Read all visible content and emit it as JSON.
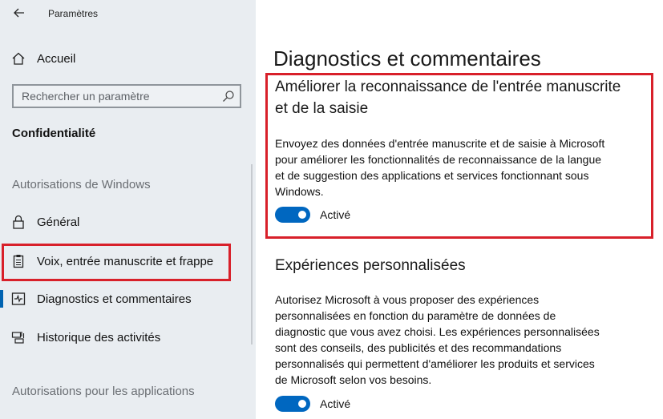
{
  "window": {
    "title": "Paramètres"
  },
  "sidebar": {
    "home_label": "Accueil",
    "search_placeholder": "Rechercher un paramètre",
    "section_title": "Confidentialité",
    "group_windows": "Autorisations de Windows",
    "items": [
      {
        "label": "Général",
        "icon": "lock-icon"
      },
      {
        "label": "Voix, entrée manuscrite et frappe",
        "icon": "clipboard-icon"
      },
      {
        "label": "Diagnostics et commentaires",
        "icon": "diagnostics-icon",
        "selected": true
      },
      {
        "label": "Historique des activités",
        "icon": "history-icon"
      }
    ],
    "group_apps": "Autorisations pour les applications"
  },
  "main": {
    "title": "Diagnostics et commentaires",
    "sections": [
      {
        "heading_line1": "Améliorer la reconnaissance de l'entrée manuscrite",
        "heading_line2": "et de la saisie",
        "body_lines": [
          "Envoyez des données d'entrée manuscrite et de saisie à Microsoft",
          "pour améliorer les fonctionnalités de reconnaissance de la langue",
          "et de suggestion des applications et services fonctionnant sous",
          "Windows."
        ],
        "toggle_state": "Activé"
      },
      {
        "heading": "Expériences personnalisées",
        "body_lines": [
          "Autorisez Microsoft à vous proposer des expériences",
          "personnalisées en fonction du paramètre de données de",
          "diagnostic que vous avez choisi. Les expériences personnalisées",
          "sont des conseils, des publicités et des recommandations",
          "personnalisés qui permettent d'améliorer les produits et services",
          "de Microsoft selon vos besoins."
        ],
        "toggle_state": "Activé"
      }
    ]
  },
  "colors": {
    "sidebar_bg": "#e9edf1",
    "accent": "#0067c0",
    "highlight": "#d8202a"
  }
}
